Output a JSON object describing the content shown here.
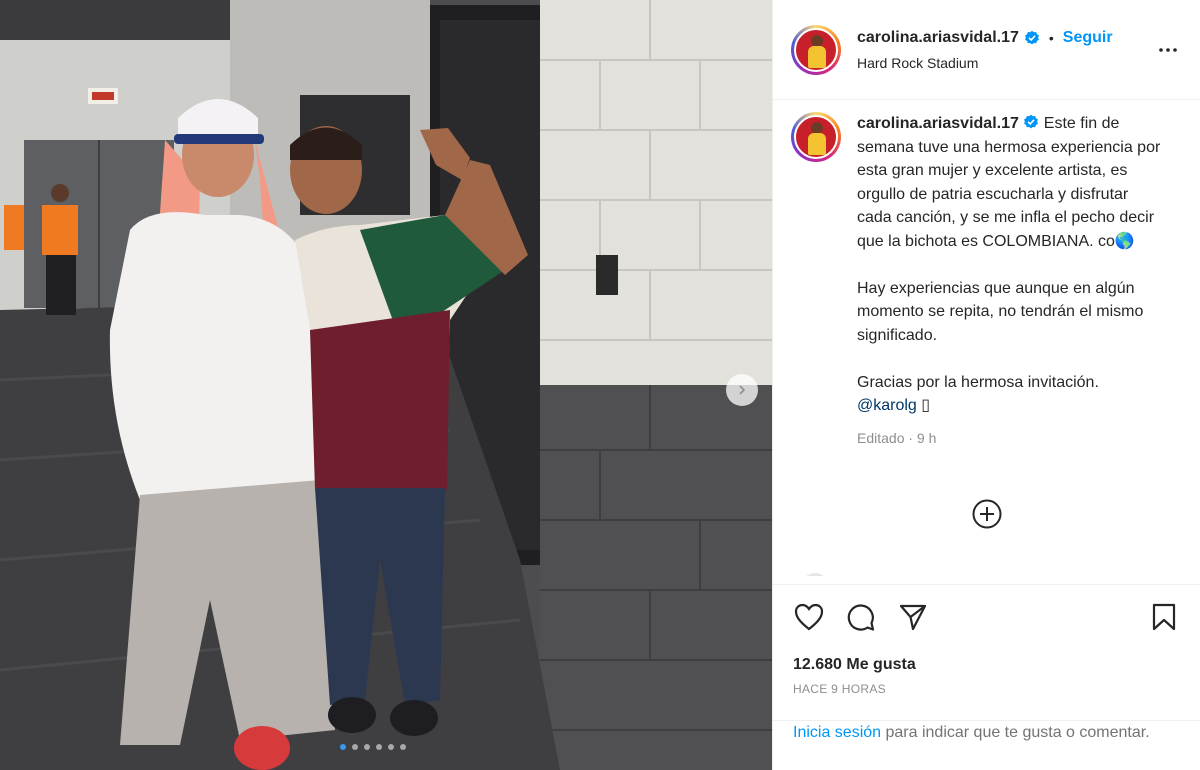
{
  "post": {
    "username": "carolina.ariasvidal.17",
    "separator": "•",
    "follow_label": "Seguir",
    "location": "Hard Rock Stadium",
    "more_icon": "more-horizontal-icon"
  },
  "caption": {
    "username": "carolina.ariasvidal.17",
    "paragraph1": "Este fin de semana tuve una hermosa experiencia por esta gran mujer y excelente artista, es orgullo de patria escucharla y disfrutar cada canción, y se me infla el pecho decir que la bichota es COLOMBIANA. co🌎",
    "paragraph2": "Hay experiencias que aunque en algún momento se repita, no tendrán el mismo significado.",
    "paragraph3": "Gracias por la hermosa invitación.",
    "mention": "@karolg",
    "trailing_glyph": "▯",
    "meta": "Editado · 9 h"
  },
  "engagement": {
    "likes": "12.680 Me gusta",
    "date": "HACE 9 HORAS"
  },
  "login_prompt": {
    "link": "Inicia sesión",
    "text": " para indicar que te gusta o comentar."
  },
  "carousel": {
    "slides": 6,
    "active_index": 0
  },
  "colors": {
    "accent": "#0095f6",
    "verified": "#0095f6",
    "text": "#262626",
    "muted": "#8e8e8e"
  }
}
